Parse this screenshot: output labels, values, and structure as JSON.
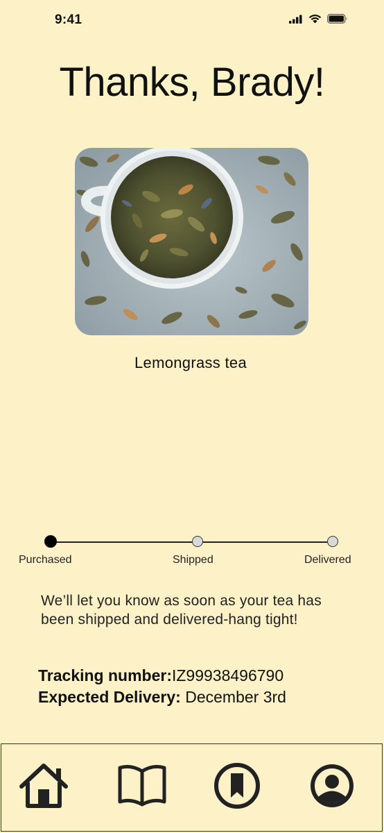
{
  "status_bar": {
    "time": "9:41",
    "icons": [
      "signal-icon",
      "wifi-icon",
      "battery-icon"
    ]
  },
  "header": {
    "title": "Thanks, Brady!"
  },
  "product": {
    "name": "Lemongrass tea",
    "image": "tea-cup-image"
  },
  "progress": {
    "steps": [
      {
        "label": "Purchased",
        "active": true
      },
      {
        "label": "Shipped",
        "active": false
      },
      {
        "label": "Delivered",
        "active": false
      }
    ]
  },
  "message": "We’ll let you know as soon as your tea has been shipped and delivered-hang tight!",
  "tracking": {
    "label": "Tracking number:",
    "value": "IZ99938496790"
  },
  "delivery": {
    "label": "Expected Delivery:",
    "value": " December 3rd"
  },
  "nav": {
    "items": [
      "home-icon",
      "book-icon",
      "bookmark-icon",
      "profile-icon"
    ]
  },
  "colors": {
    "background": "#fdf1c8",
    "text": "#111111",
    "inactive_dot": "#d9d9d9"
  }
}
